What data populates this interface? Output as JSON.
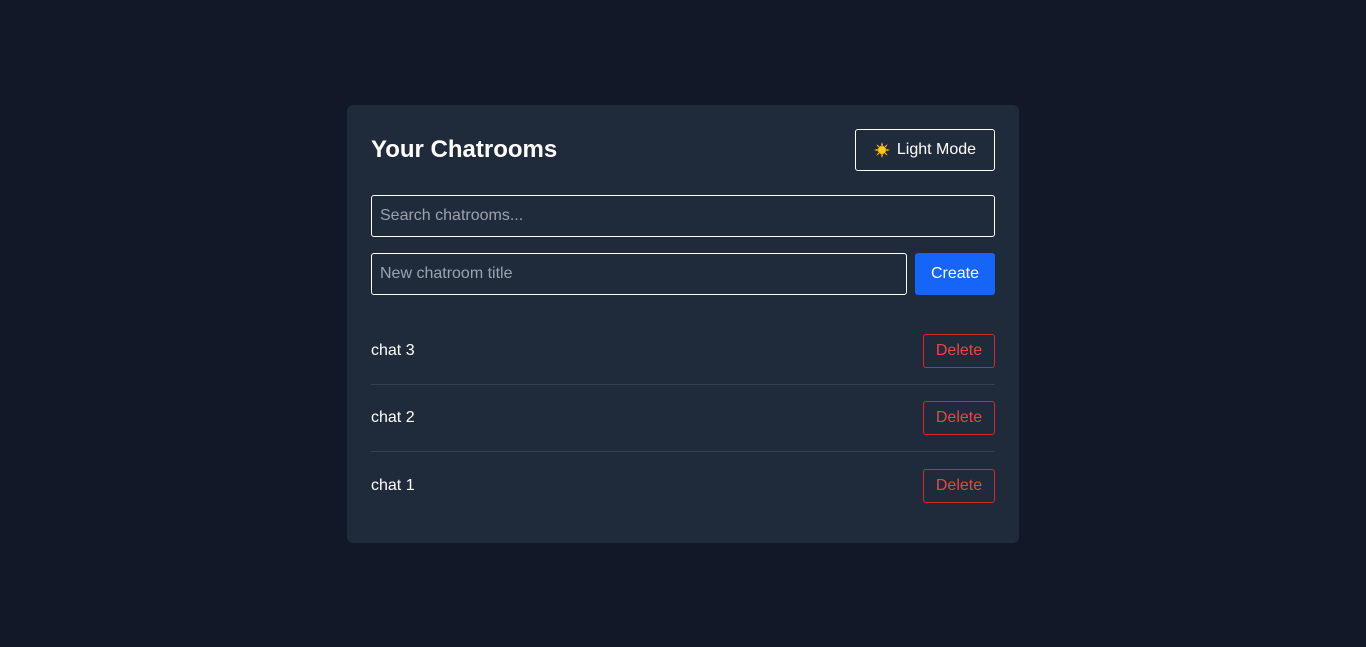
{
  "header": {
    "title": "Your Chatrooms",
    "theme_toggle_label": "Light Mode",
    "theme_toggle_icon": "sun-icon"
  },
  "search": {
    "placeholder": "Search chatrooms...",
    "value": ""
  },
  "create": {
    "placeholder": "New chatroom title",
    "value": "",
    "button_label": "Create"
  },
  "chatrooms": [
    {
      "name": "chat 3",
      "delete_label": "Delete"
    },
    {
      "name": "chat 2",
      "delete_label": "Delete"
    },
    {
      "name": "chat 1",
      "delete_label": "Delete"
    }
  ],
  "colors": {
    "page_background": "#111827",
    "card_background": "#1f2a3a",
    "primary": "#1565f9",
    "danger": "#ef4444",
    "sun": "#facc15"
  }
}
